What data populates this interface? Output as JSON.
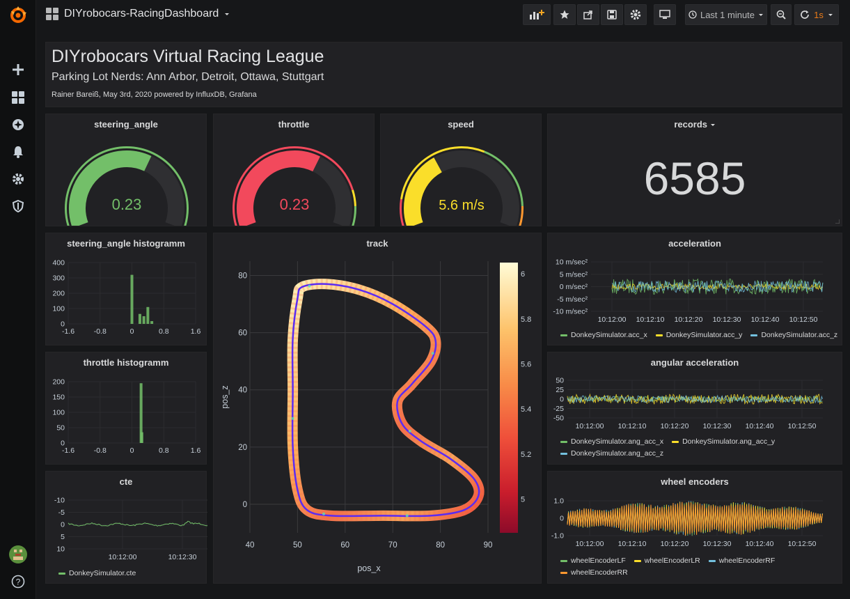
{
  "dashboard": {
    "title": "DIYrobocars-RacingDashboard",
    "time_range": "Last 1 minute",
    "refresh": "1s"
  },
  "colors": {
    "green": "#73bf69",
    "red": "#f2495c",
    "yellow": "#fade2a",
    "orange": "#ff9830",
    "blue": "#5794f2",
    "cyan": "#73c0de",
    "track_line": "#5b2bf2"
  },
  "sidemenu": {
    "icons": [
      "grafana-logo-icon",
      "plus-icon",
      "dashboards-icon",
      "explore-icon",
      "alerting-icon",
      "configuration-icon",
      "server-admin-icon",
      "user-avatar",
      "help-icon"
    ]
  },
  "toolbar": {
    "icons": [
      "add-panel-icon",
      "star-icon",
      "share-icon",
      "save-icon",
      "settings-icon",
      "tv-mode-icon",
      "clock-icon",
      "zoom-out-icon",
      "refresh-icon"
    ]
  },
  "header": {
    "title": "DIYrobocars Virtual Racing League",
    "subtitle": "Parking Lot Nerds: Ann Arbor, Detroit, Ottawa, Stuttgart",
    "credit": "Rainer Bareiß, May 3rd, 2020 powered by InfluxDB, Grafana"
  },
  "gauges": [
    {
      "title": "steering_angle",
      "value": 0.23,
      "display": "0.23",
      "min": -1,
      "max": 1,
      "fill": 0.615,
      "color": "#73bf69"
    },
    {
      "title": "throttle",
      "value": 0.23,
      "display": "0.23",
      "min": 0,
      "max": 1,
      "fill": 0.62,
      "color": "#f2495c"
    },
    {
      "title": "speed",
      "value": 5.6,
      "display": "5.6 m/s",
      "min": 0,
      "max": 15,
      "fill": 0.37,
      "color": "#fade2a"
    }
  ],
  "records": {
    "title": "records",
    "value": "6585"
  },
  "chart_data": [
    {
      "title": "steering_angle histogramm",
      "type": "bar",
      "x": [
        0,
        0.2,
        0.3,
        0.4,
        0.5
      ],
      "values": [
        320,
        65,
        50,
        110,
        18
      ],
      "xlim": [
        -1.6,
        1.6
      ],
      "ylim": [
        0,
        400
      ],
      "xticks": [
        "-1.6",
        "-0.8",
        "0",
        "0.8",
        "1.6"
      ],
      "yticks": [
        "0",
        "100",
        "200",
        "300",
        "400"
      ]
    },
    {
      "title": "throttle histogramm",
      "type": "bar",
      "x": [
        0.23,
        0.25
      ],
      "values": [
        195,
        35
      ],
      "xlim": [
        -1.6,
        1.6
      ],
      "ylim": [
        0,
        200
      ],
      "xticks": [
        "-1.6",
        "-0.8",
        "0",
        "0.8",
        "1.6"
      ],
      "yticks": [
        "0",
        "50",
        "100",
        "150",
        "200"
      ]
    },
    {
      "title": "cte",
      "type": "line",
      "series": [
        {
          "name": "DonkeySimulator.cte",
          "color": "#73bf69"
        }
      ],
      "ylim": [
        -10,
        10
      ],
      "yticks": [
        "-10",
        "-5",
        "0",
        "5",
        "10"
      ],
      "xticks": [
        "10:12:00",
        "10:12:30"
      ]
    },
    {
      "title": "track",
      "type": "scatter",
      "xlabel": "pos_x",
      "ylabel": "pos_z",
      "xlim": [
        40,
        90
      ],
      "ylim": [
        -10,
        85
      ],
      "xticks": [
        "40",
        "50",
        "60",
        "70",
        "80",
        "90"
      ],
      "yticks": [
        "0",
        "20",
        "40",
        "60",
        "80"
      ],
      "colorbar_ticks": [
        "5",
        "5.2",
        "5.4",
        "5.6",
        "5.8",
        "6"
      ],
      "points": [
        [
          50,
          5
        ],
        [
          49,
          20
        ],
        [
          49,
          40
        ],
        [
          49,
          58
        ],
        [
          50,
          72
        ],
        [
          51,
          76
        ],
        [
          56,
          77
        ],
        [
          63,
          75
        ],
        [
          70,
          70
        ],
        [
          77,
          62
        ],
        [
          79,
          57
        ],
        [
          78,
          50
        ],
        [
          74,
          42
        ],
        [
          71,
          36
        ],
        [
          72,
          28
        ],
        [
          76,
          22
        ],
        [
          82,
          16
        ],
        [
          87,
          9
        ],
        [
          88,
          3
        ],
        [
          85,
          -2
        ],
        [
          78,
          -4
        ],
        [
          68,
          -4
        ],
        [
          57,
          -4
        ],
        [
          52,
          -2
        ],
        [
          50,
          5
        ]
      ]
    },
    {
      "title": "acceleration",
      "type": "line",
      "series": [
        {
          "name": "DonkeySimulator.acc_x",
          "color": "#73bf69"
        },
        {
          "name": "DonkeySimulator.acc_y",
          "color": "#fade2a"
        },
        {
          "name": "DonkeySimulator.acc_z",
          "color": "#73c0de"
        }
      ],
      "ylim": [
        -10,
        10
      ],
      "yticks": [
        "10 m/sec²",
        "5 m/sec²",
        "0 m/sec²",
        "-5 m/sec²",
        "-10 m/sec²"
      ],
      "xticks": [
        "10:12:00",
        "10:12:10",
        "10:12:20",
        "10:12:30",
        "10:12:40",
        "10:12:50"
      ]
    },
    {
      "title": "angular acceleration",
      "type": "line",
      "series": [
        {
          "name": "DonkeySimulator.ang_acc_x",
          "color": "#73bf69"
        },
        {
          "name": "DonkeySimulator.ang_acc_y",
          "color": "#fade2a"
        },
        {
          "name": "DonkeySimulator.ang_acc_z",
          "color": "#73c0de"
        }
      ],
      "ylim": [
        -50,
        50
      ],
      "yticks": [
        "50",
        "25",
        "0",
        "-25",
        "-50"
      ],
      "xticks": [
        "10:12:00",
        "10:12:10",
        "10:12:20",
        "10:12:30",
        "10:12:40",
        "10:12:50"
      ]
    },
    {
      "title": "wheel encoders",
      "type": "line",
      "series": [
        {
          "name": "wheelEncoderLF",
          "color": "#73bf69"
        },
        {
          "name": "wheelEncoderLR",
          "color": "#fade2a"
        },
        {
          "name": "wheelEncoderRF",
          "color": "#73c0de"
        },
        {
          "name": "wheelEncoderRR",
          "color": "#ff9830"
        }
      ],
      "ylim": [
        -1,
        1
      ],
      "yticks": [
        "1.0",
        "0",
        "-1.0"
      ],
      "xticks": [
        "10:12:00",
        "10:12:10",
        "10:12:20",
        "10:12:30",
        "10:12:40",
        "10:12:50"
      ]
    }
  ]
}
